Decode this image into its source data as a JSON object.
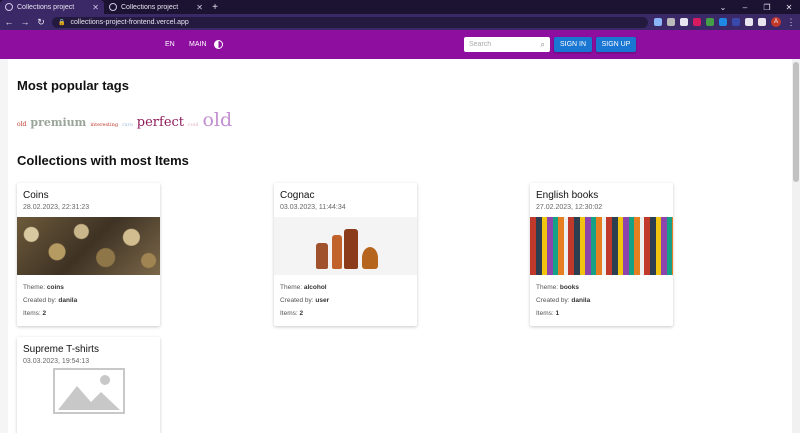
{
  "browser": {
    "tabs": [
      {
        "title": "Collections project",
        "active": true
      },
      {
        "title": "Collections project",
        "active": false
      }
    ],
    "url": "collections-project-frontend.vercel.app",
    "profile_initial": "A"
  },
  "header": {
    "language": "EN",
    "main_label": "MAIN",
    "search_placeholder": "Search",
    "signin_label": "SIGN IN",
    "signup_label": "SIGN UP",
    "brand_color": "#8e0ea0",
    "button_color": "#1976d2"
  },
  "tags_section": {
    "heading": "Most popular tags",
    "tags": [
      {
        "label": "old",
        "color": "#c0392b"
      },
      {
        "label": "premium",
        "color": "#9aa59a"
      },
      {
        "label": "interesting",
        "color": "#c0392b"
      },
      {
        "label": "rare",
        "color": "#9fbfdf"
      },
      {
        "label": "perfect",
        "color": "#8e1b5a"
      },
      {
        "label": "cool",
        "color": "#e0b0c0"
      },
      {
        "label": "old",
        "color": "#c38fd1"
      }
    ]
  },
  "collections_section": {
    "heading": "Collections with most Items",
    "theme_label": "Theme:",
    "created_label": "Created by:",
    "items_label": "Items:",
    "cards": [
      {
        "title": "Coins",
        "date": "28.02.2023, 22:31:23",
        "theme": "coins",
        "author": "danila",
        "items": "2",
        "image": "coins-image"
      },
      {
        "title": "Cognac",
        "date": "03.03.2023, 11:44:34",
        "theme": "alcohol",
        "author": "user",
        "items": "2",
        "image": "cognac-image"
      },
      {
        "title": "English books",
        "date": "27.02.2023, 12:30:02",
        "theme": "books",
        "author": "danila",
        "items": "1",
        "image": "books-image"
      },
      {
        "title": "Supreme T-shirts",
        "date": "03.03.2023, 19:54:13",
        "image": "placeholder-image-icon"
      }
    ]
  }
}
